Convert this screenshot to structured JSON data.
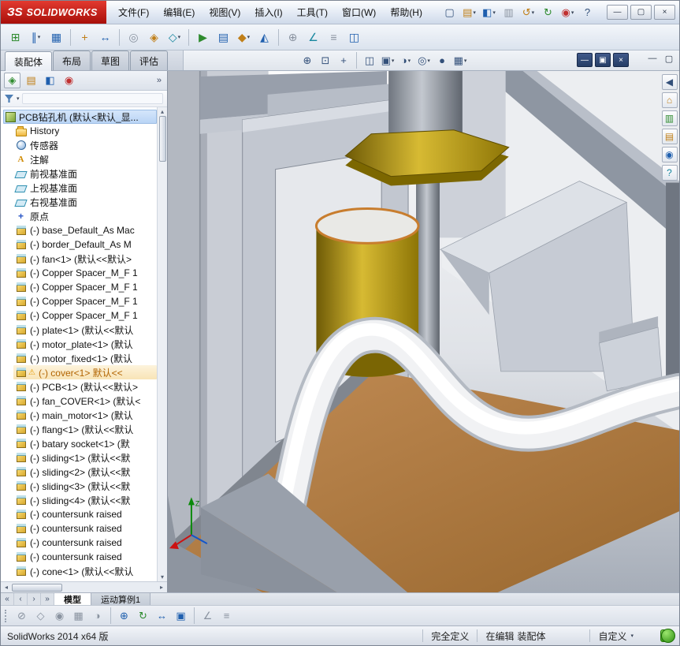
{
  "ui": {
    "caret": "▾",
    "warn": "⚠",
    "more": "»"
  },
  "window": {
    "logo_mark": "ЗS",
    "logo_text": "SOLIDWORKS",
    "min": "—",
    "max": "▢",
    "close": "×"
  },
  "menubar": {
    "file": "文件(F)",
    "edit": "编辑(E)",
    "view": "视图(V)",
    "insert": "插入(I)",
    "tools": "工具(T)",
    "window": "窗口(W)",
    "help": "帮助(H)"
  },
  "quickbar": [
    {
      "n": "new-document-icon",
      "g": "▢"
    },
    {
      "n": "open-icon",
      "g": "▤"
    },
    {
      "n": "save-icon",
      "g": "◧"
    },
    {
      "n": "print-icon",
      "g": "▥"
    },
    {
      "n": "undo-icon",
      "g": "↺"
    },
    {
      "n": "rebuild-icon",
      "g": "↻"
    },
    {
      "n": "options-icon",
      "g": "◉"
    },
    {
      "n": "help-icon",
      "g": "?"
    }
  ],
  "toolbar2": [
    {
      "n": "insert-components-icon",
      "g": "⊞"
    },
    {
      "n": "mate-icon",
      "g": "∥"
    },
    {
      "n": "component-pattern-icon",
      "g": "▦"
    },
    {
      "n": "smart-fasteners-icon",
      "g": "+"
    },
    {
      "n": "move-component-icon",
      "g": "↔"
    },
    {
      "n": "show-hidden-components-icon",
      "g": "◎"
    },
    {
      "n": "assembly-features-icon",
      "g": "◈"
    },
    {
      "n": "reference-geometry-icon",
      "g": "◇"
    },
    {
      "n": "motion-study-icon",
      "g": "▶"
    },
    {
      "n": "bill-of-materials-icon",
      "g": "▤"
    },
    {
      "n": "exploded-view-icon",
      "g": "◆"
    },
    {
      "n": "instant3d-icon",
      "g": "◭"
    },
    {
      "n": "interference-detection-icon",
      "g": "⊕"
    },
    {
      "n": "sketch-icon",
      "g": "∠"
    },
    {
      "n": "measure-icon",
      "g": "≡"
    },
    {
      "n": "section-view-icon",
      "g": "◫"
    }
  ],
  "tabs": {
    "assembly": "装配体",
    "layout": "布局",
    "sketch": "草图",
    "evaluate": "评估"
  },
  "hud": [
    {
      "n": "zoom-fit-icon",
      "g": "⊕"
    },
    {
      "n": "zoom-area-icon",
      "g": "⊡"
    },
    {
      "n": "pan-icon",
      "g": "+"
    },
    {
      "n": "section-view-icon",
      "g": "◫"
    },
    {
      "n": "view-orientation-icon",
      "g": "▣"
    },
    {
      "n": "display-style-icon",
      "g": "◑"
    },
    {
      "n": "hide-show-items-icon",
      "g": "◎"
    },
    {
      "n": "appearances-icon",
      "g": "●"
    },
    {
      "n": "scene-icon",
      "g": "▦"
    }
  ],
  "docbtns": {
    "min": "—",
    "restore": "▣",
    "close": "×"
  },
  "flatbtns": {
    "min": "—",
    "restore": "▢"
  },
  "panel": {
    "icons": [
      {
        "n": "feature-manager-icon",
        "g": "◈"
      },
      {
        "n": "property-manager-icon",
        "g": "▤"
      },
      {
        "n": "configuration-manager-icon",
        "g": "◧"
      },
      {
        "n": "appearance-manager-icon",
        "g": "◉"
      }
    ]
  },
  "icons": {
    "note": "A",
    "origin": "+"
  },
  "tree": [
    {
      "label": "PCB钻孔机 (默认<默认_显..."
    },
    {
      "label": "History"
    },
    {
      "label": "传感器"
    },
    {
      "label": "注解"
    },
    {
      "label": "前视基准面"
    },
    {
      "label": "上视基准面"
    },
    {
      "label": "右视基准面"
    },
    {
      "label": "原点"
    },
    {
      "label": "(-) base_Default_As Mac"
    },
    {
      "label": "(-) border_Default_As M"
    },
    {
      "label": "(-) fan<1> (默认<<默认>"
    },
    {
      "label": "(-) Copper Spacer_M_F 1"
    },
    {
      "label": "(-) Copper Spacer_M_F 1"
    },
    {
      "label": "(-) Copper Spacer_M_F 1"
    },
    {
      "label": "(-) Copper Spacer_M_F 1"
    },
    {
      "label": "(-) plate<1> (默认<<默认"
    },
    {
      "label": "(-) motor_plate<1> (默认"
    },
    {
      "label": "(-) motor_fixed<1> (默认"
    },
    {
      "label": "(-) cover<1> 默认<<"
    },
    {
      "label": "(-) PCB<1> (默认<<默认>"
    },
    {
      "label": "(-) fan_COVER<1> (默认<"
    },
    {
      "label": "(-) main_motor<1> (默认"
    },
    {
      "label": "(-) flang<1> (默认<<默认"
    },
    {
      "label": "(-) batary socket<1> (默"
    },
    {
      "label": "(-) sliding<1> (默认<<默"
    },
    {
      "label": "(-) sliding<2> (默认<<默"
    },
    {
      "label": "(-) sliding<3> (默认<<默"
    },
    {
      "label": "(-) sliding<4> (默认<<默"
    },
    {
      "label": "(-) countersunk raised"
    },
    {
      "label": "(-) countersunk raised"
    },
    {
      "label": "(-) countersunk raised"
    },
    {
      "label": "(-) countersunk raised"
    },
    {
      "label": "(-) cone<1> (默认<<默认"
    }
  ],
  "taskpane": [
    {
      "n": "collapse-arrow-icon",
      "g": "◀"
    },
    {
      "n": "home-icon",
      "g": "⌂"
    },
    {
      "n": "design-library-icon",
      "g": "▥"
    },
    {
      "n": "file-explorer-icon",
      "g": "▤"
    },
    {
      "n": "appearances-scenes-icon",
      "g": "◉"
    },
    {
      "n": "custom-properties-icon",
      "g": "?"
    }
  ],
  "viewport": {
    "origin_label": "Z"
  },
  "bottom": {
    "nav": [
      "«",
      "‹",
      "›",
      "»"
    ],
    "model_tab": "模型",
    "motion_tab": "运动算例1"
  },
  "toolbar3": [
    {
      "n": "no-section-icon",
      "g": "⊘"
    },
    {
      "n": "hide-all-types-icon",
      "g": "◇"
    },
    {
      "n": "edit-appearance-icon",
      "g": "◉"
    },
    {
      "n": "apply-scene-icon",
      "g": "▦"
    },
    {
      "n": "view-settings-icon",
      "g": "◑"
    },
    {
      "n": "zoom-tool-icon",
      "g": "⊕"
    },
    {
      "n": "rotate-view-icon",
      "g": "↻"
    },
    {
      "n": "pan-view-icon",
      "g": "↔"
    },
    {
      "n": "orientation-cube-icon",
      "g": "▣"
    },
    {
      "n": "sketch-tool-icon",
      "g": "∠"
    },
    {
      "n": "measure-tool-icon",
      "g": "≡"
    }
  ],
  "status": {
    "app": "SolidWorks 2014 x64 版",
    "state": "完全定义",
    "editing": "在编辑",
    "mode": "装配体",
    "custom": "自定义",
    "help": "?"
  }
}
